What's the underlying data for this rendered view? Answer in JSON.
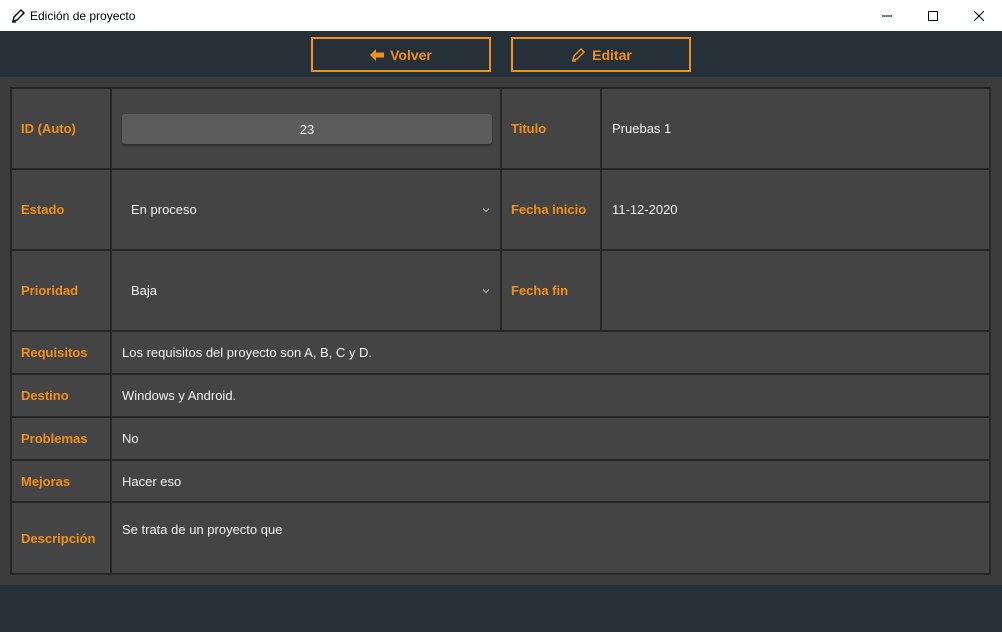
{
  "window": {
    "title": "Edición de proyecto",
    "icon": "pen-icon",
    "controls": [
      "minimize-icon",
      "maximize-icon",
      "close-icon"
    ]
  },
  "toolbar": {
    "back_label": "Volver",
    "back_icon": "arrow-left-icon",
    "edit_label": "Editar",
    "edit_icon": "pen-icon"
  },
  "form": {
    "id": {
      "label": "ID (Auto)",
      "value": "23"
    },
    "title": {
      "label": "Titulo",
      "value": "Pruebas 1"
    },
    "status": {
      "label": "Estado",
      "value": "En proceso"
    },
    "start_date": {
      "label": "Fecha inicio",
      "value": "11-12-2020"
    },
    "priority": {
      "label": "Prioridad",
      "value": "Baja"
    },
    "end_date": {
      "label": "Fecha fin",
      "value": ""
    },
    "requirements": {
      "label": "Requisitos",
      "value": "Los requisitos del proyecto son A, B, C y D."
    },
    "target": {
      "label": "Destino",
      "value": "Windows y Android."
    },
    "problems": {
      "label": "Problemas",
      "value": "No"
    },
    "improvements": {
      "label": "Mejoras",
      "value": "Hacer eso"
    },
    "description": {
      "label": "Descripción",
      "value": "Se trata de un proyecto que"
    }
  },
  "colors": {
    "accent": "#f0901e",
    "background": "#263038",
    "panel": "#444444",
    "grid": "#262626"
  }
}
